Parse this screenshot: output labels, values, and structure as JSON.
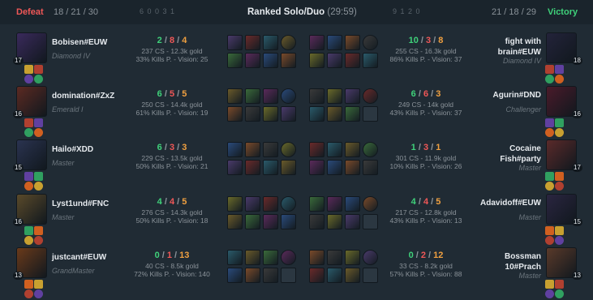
{
  "header": {
    "defeat_label": "Defeat",
    "left_kda": "18 / 21 / 30",
    "left_objectives": "6 0 0 3 1",
    "title": "Ranked Solo/Duo",
    "duration": "(29:59)",
    "right_objectives": "9 1 2 0",
    "right_kda": "21 / 18 / 29",
    "victory_label": "Victory"
  },
  "rows": [
    {
      "left": {
        "name": "Bobisen#EUW",
        "rank": "Diamond IV",
        "level": "17",
        "k": "2",
        "d": "8",
        "a": "4",
        "cs_gold": "237 CS - 12.3k gold",
        "kp_vision": "33% Kills P. - Vision: 25"
      },
      "right": {
        "name": "fight with brain#EUW",
        "rank": "Diamond IV",
        "level": "18",
        "k": "10",
        "d": "3",
        "a": "8",
        "cs_gold": "255 CS - 16.3k gold",
        "kp_vision": "86% Kills P. - Vision: 37"
      }
    },
    {
      "left": {
        "name": "domination#ZxZ",
        "rank": "Emerald I",
        "level": "16",
        "k": "6",
        "d": "5",
        "a": "5",
        "cs_gold": "250 CS - 14.4k gold",
        "kp_vision": "61% Kills P. - Vision: 19"
      },
      "right": {
        "name": "Agurin#DND",
        "rank": "Challenger",
        "level": "16",
        "k": "6",
        "d": "6",
        "a": "3",
        "cs_gold": "249 CS - 14k gold",
        "kp_vision": "43% Kills P. - Vision: 37"
      }
    },
    {
      "left": {
        "name": "Hailo#XDD",
        "rank": "Master",
        "level": "15",
        "k": "6",
        "d": "3",
        "a": "3",
        "cs_gold": "229 CS - 13.5k gold",
        "kp_vision": "50% Kills P. - Vision: 21"
      },
      "right": {
        "name": "Cocaine Fish#party",
        "rank": "Master",
        "level": "17",
        "k": "1",
        "d": "3",
        "a": "1",
        "cs_gold": "301 CS - 11.9k gold",
        "kp_vision": "10% Kills P. - Vision: 26"
      }
    },
    {
      "left": {
        "name": "Lyst1und#FNC",
        "rank": "Master",
        "level": "16",
        "k": "4",
        "d": "4",
        "a": "5",
        "cs_gold": "276 CS - 14.3k gold",
        "kp_vision": "50% Kills P. - Vision: 18"
      },
      "right": {
        "name": "Adavidoff#EUW",
        "rank": "Master",
        "level": "15",
        "k": "4",
        "d": "4",
        "a": "5",
        "cs_gold": "217 CS - 12.8k gold",
        "kp_vision": "43% Kills P. - Vision: 13"
      }
    },
    {
      "left": {
        "name": "justcant#EUW",
        "rank": "GrandMaster",
        "level": "13",
        "k": "0",
        "d": "1",
        "a": "13",
        "cs_gold": "40 CS - 8.5k gold",
        "kp_vision": "72% Kills P. - Vision: 140"
      },
      "right": {
        "name": "Bossman 10#Prach",
        "rank": "Master",
        "level": "13",
        "k": "0",
        "d": "2",
        "a": "12",
        "cs_gold": "33 CS - 8.2k gold",
        "kp_vision": "57% Kills P. - Vision: 88"
      }
    }
  ],
  "colors": {
    "kills": "#3fd17a",
    "deaths": "#ef5757",
    "assists": "#f0a040",
    "defeat": "#ef5757",
    "victory": "#3fd17a",
    "background": "#202b34"
  },
  "icons": {
    "champion_portrait": "champion-portrait",
    "summoner_spell": "summoner-spell-icon",
    "rune": "rune-icon",
    "item": "item-icon"
  }
}
